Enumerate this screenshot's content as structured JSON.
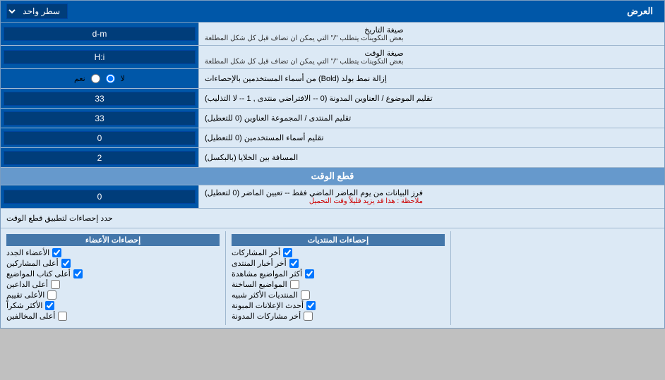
{
  "page": {
    "header": {
      "title": "سطر واحد",
      "title_label": "العرض"
    },
    "date_format": {
      "label": "صيغة التاريخ",
      "note": "بعض التكوينات يتطلب \"/\" التي يمكن ان تضاف قبل كل شكل المطلعة",
      "value": "d-m"
    },
    "time_format": {
      "label": "صيغة الوقت",
      "note": "بعض التكوينات يتطلب \"/\" التي يمكن ان تضاف قبل كل شكل المطلعة",
      "value": "H:i"
    },
    "bold_remove": {
      "label": "إزالة نمط بولد (Bold) من أسماء المستخدمين بالإحصاءات",
      "radio_yes": "نعم",
      "radio_no": "لا",
      "selected": "no"
    },
    "topic_limit": {
      "label": "تقليم الموضوع / العناوين المدونة (0 -- الافتراضي منتدى , 1 -- لا التذليب)",
      "value": "33"
    },
    "forum_limit": {
      "label": "تقليم المنتدى / المجموعة العناوين (0 للتعطيل)",
      "value": "33"
    },
    "user_limit": {
      "label": "تقليم أسماء المستخدمين (0 للتعطيل)",
      "value": "0"
    },
    "space_between": {
      "label": "المسافة بين الخلايا (بالبكسل)",
      "value": "2"
    },
    "time_cut_section": {
      "title": "قطع الوقت"
    },
    "time_cut": {
      "label": "فرز البيانات من يوم الماضر الماضي فقط -- تعيين الماضر (0 لتعطيل)",
      "note": "ملاحظة : هذا قد يزيد قليلاً وقت التحميل",
      "value": "0"
    },
    "limit_stats": {
      "label": "حدد إحصاءات لتطبيق قطع الوقت"
    },
    "col_posts": {
      "header": "إحصاءات المنتديات",
      "items": [
        {
          "label": "أخر المشاركات",
          "checked": true
        },
        {
          "label": "أخر أخبار المنتدى",
          "checked": true
        },
        {
          "label": "أكثر المواضيع مشاهدة",
          "checked": true
        },
        {
          "label": "المواضيع الساخنة",
          "checked": false
        },
        {
          "label": "المنتديات الأكثر شبيه",
          "checked": false
        },
        {
          "label": "أحدث الإعلانات المبونة",
          "checked": true
        },
        {
          "label": "أخر مشاركات المدونة",
          "checked": false
        }
      ]
    },
    "col_members": {
      "header": "إحصاءات الأعضاء",
      "items": [
        {
          "label": "الأعضاء الجدد",
          "checked": true
        },
        {
          "label": "أعلى المشاركين",
          "checked": true
        },
        {
          "label": "أعلى كتاب المواضيع",
          "checked": true
        },
        {
          "label": "أعلى الداعين",
          "checked": false
        },
        {
          "label": "الأعلى تقييم",
          "checked": false
        },
        {
          "label": "الأكثر شكراً",
          "checked": true
        },
        {
          "label": "أعلى المخالفين",
          "checked": false
        }
      ]
    }
  }
}
